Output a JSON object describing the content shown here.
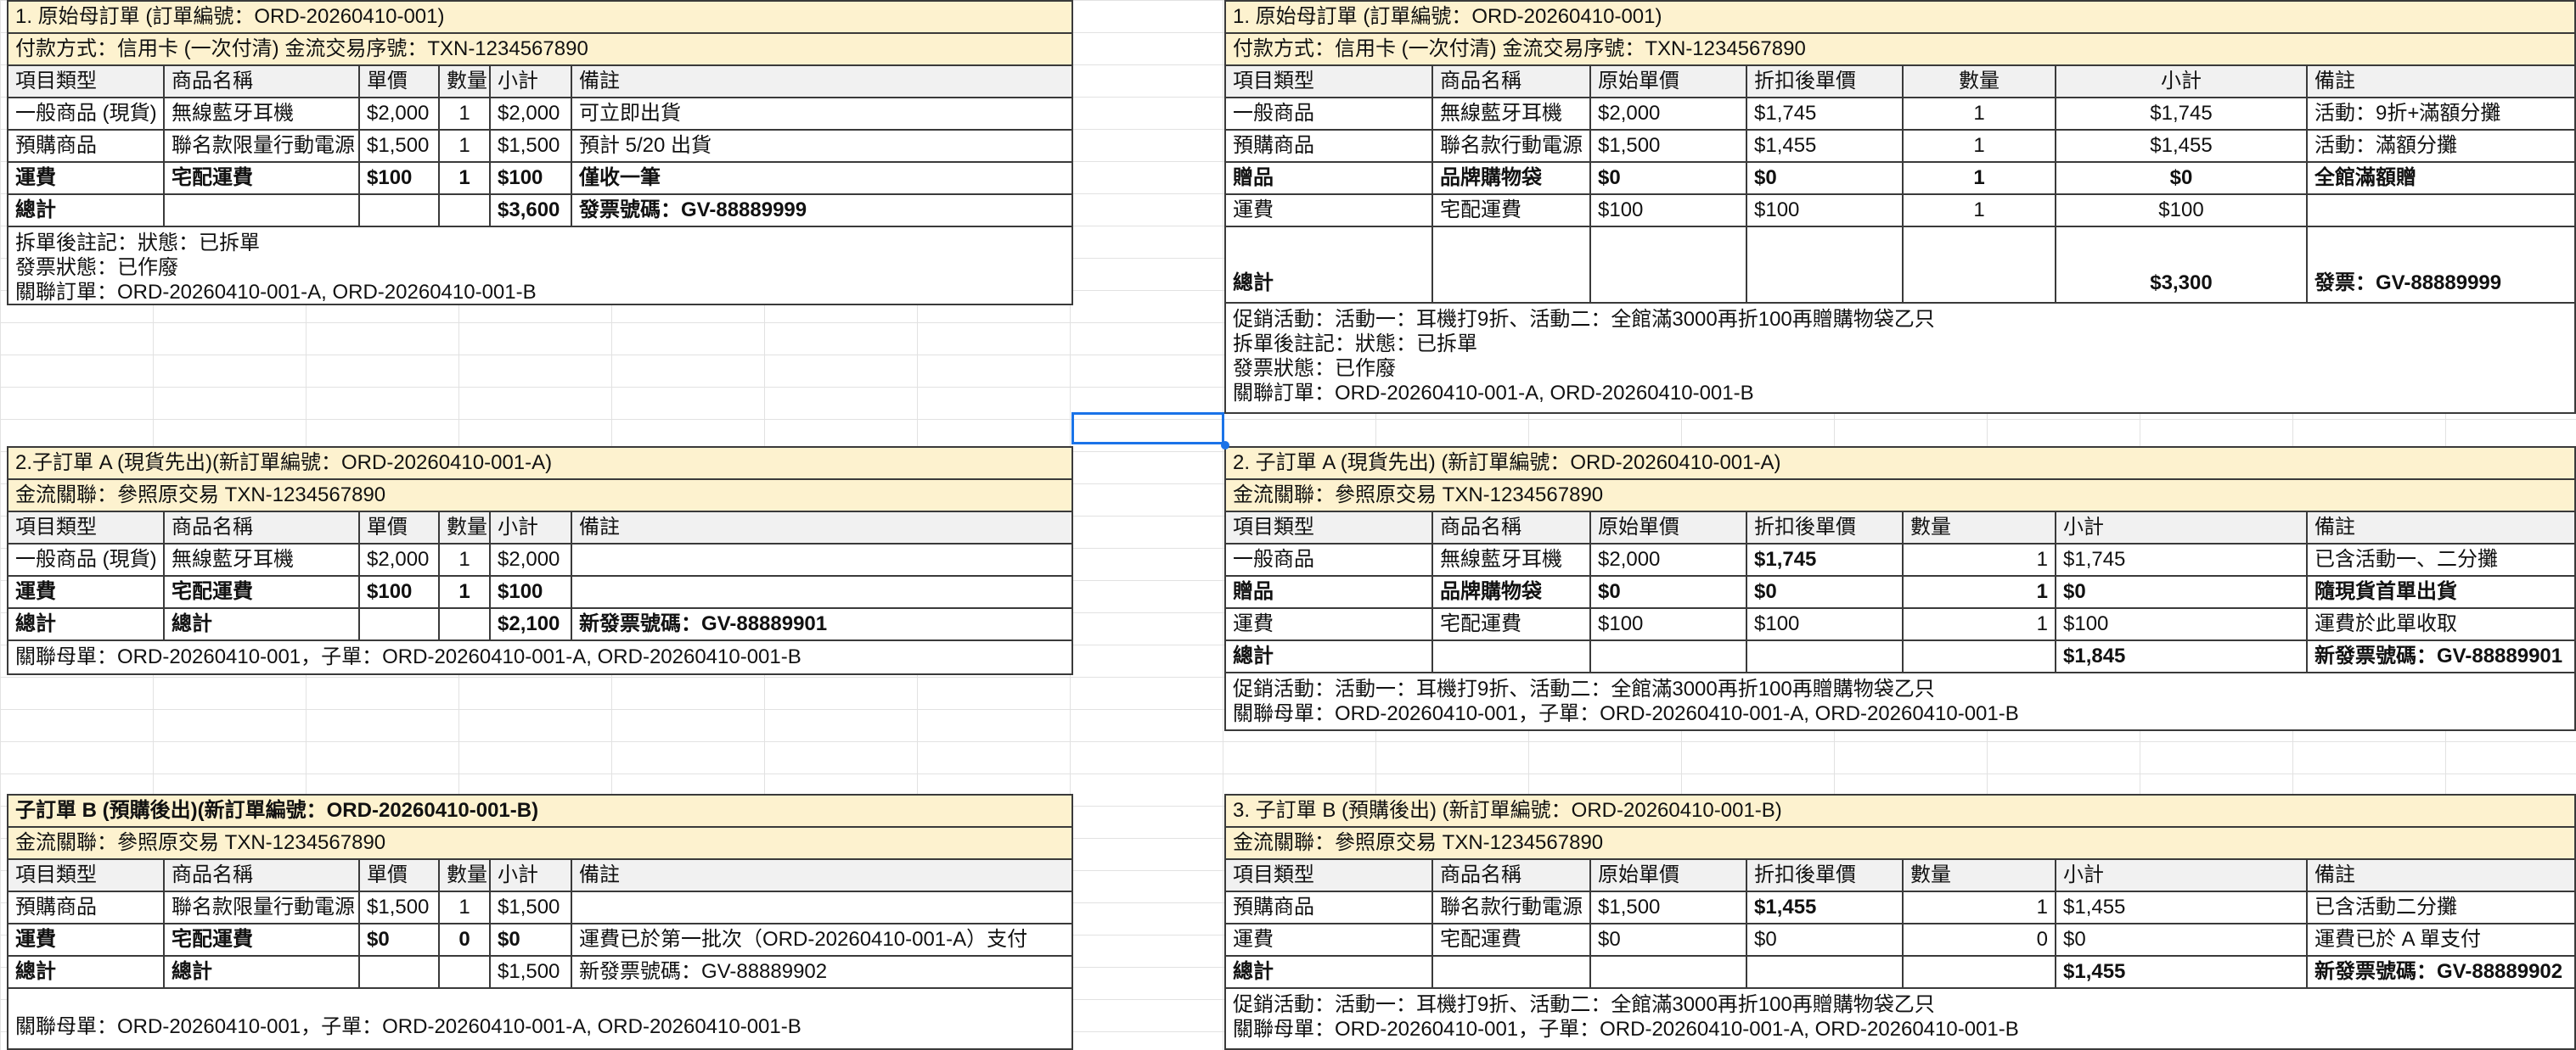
{
  "left": {
    "b1": {
      "title": "1. 原始母訂單 (訂單編號：ORD-20260410-001)",
      "payment": "付款方式：信用卡 (一次付清)   金流交易序號：TXN-1234567890",
      "headers": [
        "項目類型",
        "商品名稱",
        "單價",
        "數量",
        "小計",
        "備註"
      ],
      "rows": [
        [
          "一般商品 (現貨)",
          "無線藍牙耳機",
          "$2,000",
          "1",
          "$2,000",
          "可立即出貨"
        ],
        [
          "預購商品",
          "聯名款限量行動電源",
          "$1,500",
          "1",
          "$1,500",
          "預計 5/20 出貨"
        ],
        [
          "運費",
          "宅配運費",
          "$100",
          "1",
          "$100",
          "僅收一筆"
        ]
      ],
      "total": [
        "總計",
        "",
        "",
        "",
        "$3,600",
        "發票號碼：GV-88889999"
      ],
      "notes": [
        "拆單後註記：狀態：已拆單",
        "發票狀態：已作廢",
        "關聯訂單：ORD-20260410-001-A, ORD-20260410-001-B"
      ]
    },
    "b2": {
      "title": "2.子訂單 A (現貨先出)(新訂單編號：ORD-20260410-001-A)",
      "payment": "金流關聯：參照原交易 TXN-1234567890",
      "headers": [
        "項目類型",
        "商品名稱",
        "單價",
        "數量",
        "小計",
        "備註"
      ],
      "rows": [
        [
          "一般商品 (現貨)",
          "無線藍牙耳機",
          "$2,000",
          "1",
          "$2,000",
          ""
        ],
        [
          "運費",
          "宅配運費",
          "$100",
          "1",
          "$100",
          ""
        ]
      ],
      "total": [
        "總計",
        "總計",
        "",
        "",
        "$2,100",
        "新發票號碼：GV-88889901"
      ],
      "notes": [
        "關聯母單：ORD-20260410-001，子單：ORD-20260410-001-A, ORD-20260410-001-B"
      ]
    },
    "b3": {
      "title": "子訂單 B (預購後出)(新訂單編號：ORD-20260410-001-B)",
      "payment": "金流關聯：參照原交易 TXN-1234567890",
      "headers": [
        "項目類型",
        "商品名稱",
        "單價",
        "數量",
        "小計",
        "備註"
      ],
      "rows": [
        [
          "預購商品",
          "聯名款限量行動電源",
          "$1,500",
          "1",
          "$1,500",
          ""
        ],
        [
          "運費",
          "宅配運費",
          "$0",
          "0",
          "$0",
          "運費已於第一批次（ORD-20260410-001-A）支付"
        ]
      ],
      "total": [
        "總計",
        "總計",
        "",
        "",
        "$1,500",
        "新發票號碼：GV-88889902"
      ],
      "notes": [
        "關聯母單：ORD-20260410-001，子單：ORD-20260410-001-A, ORD-20260410-001-B"
      ]
    }
  },
  "right": {
    "b1": {
      "title": "1. 原始母訂單 (訂單編號：ORD-20260410-001)",
      "payment": "付款方式：信用卡 (一次付清)   金流交易序號：TXN-1234567890",
      "headers": [
        "項目類型",
        "商品名稱",
        "原始單價",
        "折扣後單價",
        "數量",
        "小計",
        "備註"
      ],
      "rows": [
        [
          "一般商品",
          "無線藍牙耳機",
          "$2,000",
          "$1,745",
          "1",
          "$1,745",
          "活動：9折+滿額分攤"
        ],
        [
          "預購商品",
          "聯名款行動電源",
          "$1,500",
          "$1,455",
          "1",
          "$1,455",
          "活動：滿額分攤"
        ],
        [
          "贈品",
          "品牌購物袋",
          "$0",
          "$0",
          "1",
          "$0",
          "全館滿額贈"
        ],
        [
          "運費",
          "宅配運費",
          "$100",
          "$100",
          "1",
          "$100",
          ""
        ]
      ],
      "total": [
        "總計",
        "",
        "",
        "",
        "",
        "$3,300",
        "發票：GV-88889999"
      ],
      "notes": [
        "促銷活動：活動一：耳機打9折、活動二：全館滿3000再折100再贈購物袋乙只",
        "拆單後註記：狀態：已拆單",
        "發票狀態：已作廢",
        "關聯訂單：ORD-20260410-001-A, ORD-20260410-001-B"
      ]
    },
    "b2": {
      "title": "2. 子訂單 A (現貨先出) (新訂單編號：ORD-20260410-001-A)",
      "payment": "金流關聯：參照原交易 TXN-1234567890",
      "headers": [
        "項目類型",
        "商品名稱",
        "原始單價",
        "折扣後單價",
        "數量",
        "小計",
        "備註"
      ],
      "rows": [
        [
          "一般商品",
          "無線藍牙耳機",
          "$2,000",
          "$1,745",
          "1",
          "$1,745",
          "已含活動一、二分攤"
        ],
        [
          "贈品",
          "品牌購物袋",
          "$0",
          "$0",
          "1",
          "$0",
          "隨現貨首單出貨"
        ],
        [
          "運費",
          "宅配運費",
          "$100",
          "$100",
          "1",
          "$100",
          "運費於此單收取"
        ]
      ],
      "total": [
        "總計",
        "",
        "",
        "",
        "",
        "$1,845",
        "新發票號碼：GV-88889901"
      ],
      "notes": [
        "促銷活動：活動一：耳機打9折、活動二：全館滿3000再折100再贈購物袋乙只",
        "關聯母單：ORD-20260410-001，子單：ORD-20260410-001-A, ORD-20260410-001-B"
      ]
    },
    "b3": {
      "title": "3. 子訂單 B (預購後出) (新訂單編號：ORD-20260410-001-B)",
      "payment": "金流關聯：參照原交易 TXN-1234567890",
      "headers": [
        "項目類型",
        "商品名稱",
        "原始單價",
        "折扣後單價",
        "數量",
        "小計",
        "備註"
      ],
      "rows": [
        [
          "預購商品",
          "聯名款行動電源",
          "$1,500",
          "$1,455",
          "1",
          "$1,455",
          "已含活動二分攤"
        ],
        [
          "運費",
          "宅配運費",
          "$0",
          "$0",
          "0",
          "$0",
          "運費已於 A 單支付"
        ]
      ],
      "total": [
        "總計",
        "",
        "",
        "",
        "",
        "$1,455",
        "新發票號碼：GV-88889902"
      ],
      "notes": [
        "促銷活動：活動一：耳機打9折、活動二：全館滿3000再折100再贈購物袋乙只",
        "關聯母單：ORD-20260410-001，子單：ORD-20260410-001-A, ORD-20260410-001-B"
      ]
    }
  }
}
